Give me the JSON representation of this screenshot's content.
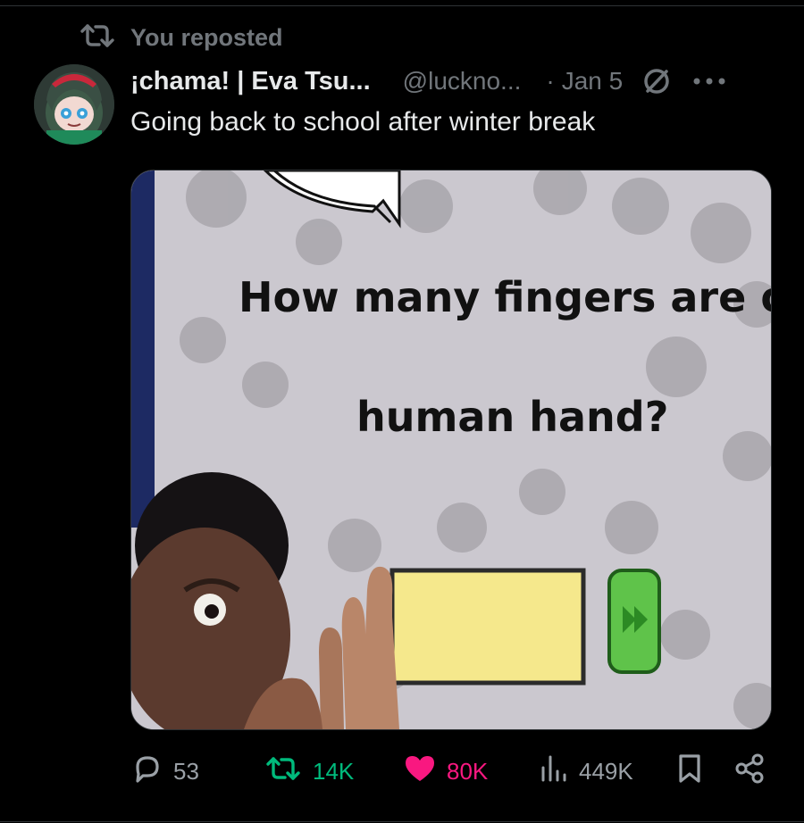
{
  "repost_banner": {
    "text": "You reposted"
  },
  "post": {
    "display_name": "¡chama! | Eva Tsu...",
    "handle": "@luckno...",
    "separator": "·",
    "date": "Jan 5",
    "text": "Going back to school after winter break",
    "media": {
      "caption_line1": "How many fingers are on a",
      "caption_line2": "human hand?"
    },
    "actions": {
      "replies": "53",
      "reposts": "14K",
      "likes": "80K",
      "views": "449K"
    }
  },
  "icons": {
    "repost": "repost-icon",
    "reply": "reply-icon",
    "like": "heart-icon",
    "views": "views-icon",
    "bookmark": "bookmark-icon",
    "share": "share-icon",
    "more": "more-icon",
    "status": "status-ring-icon"
  },
  "colors": {
    "background": "#000000",
    "text": "#e7e9ea",
    "muted": "#71767b",
    "repost_green": "#00ba7c",
    "like_pink": "#f91880"
  }
}
